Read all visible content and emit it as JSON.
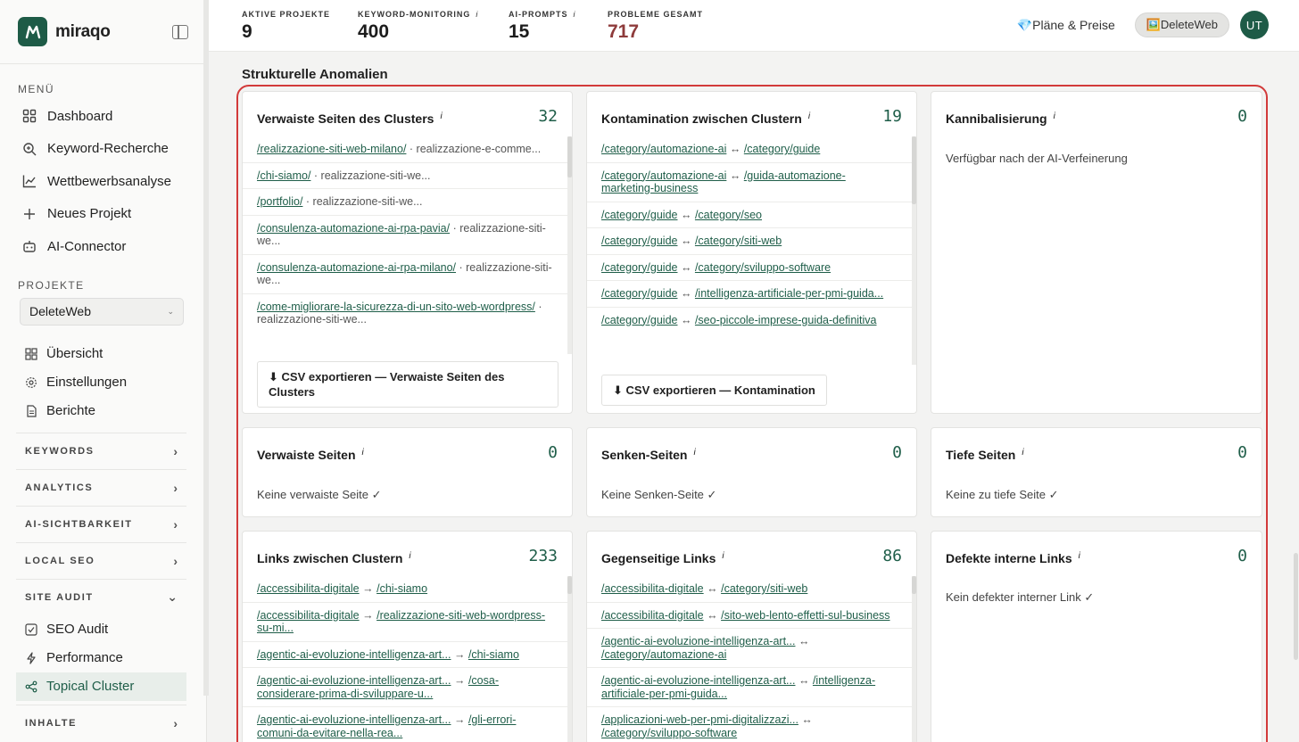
{
  "app": {
    "logo_text": "miraqo"
  },
  "sidebar": {
    "menu_label": "MENÜ",
    "menu_items": [
      {
        "label": "Dashboard",
        "icon": "dashboard-icon"
      },
      {
        "label": "Keyword-Recherche",
        "icon": "search-icon"
      },
      {
        "label": "Wettbewerbsanalyse",
        "icon": "chart-icon"
      },
      {
        "label": "Neues Projekt",
        "icon": "plus-icon"
      },
      {
        "label": "AI-Connector",
        "icon": "robot-icon"
      }
    ],
    "projects_label": "PROJEKTE",
    "project_selected": "DeleteWeb",
    "project_items": [
      {
        "label": "Übersicht",
        "icon": "grid-icon"
      },
      {
        "label": "Einstellungen",
        "icon": "gear-icon"
      },
      {
        "label": "Berichte",
        "icon": "document-icon"
      }
    ],
    "groups": [
      {
        "label": "KEYWORDS"
      },
      {
        "label": "ANALYTICS"
      },
      {
        "label": "AI-SICHTBARKEIT"
      },
      {
        "label": "LOCAL SEO"
      },
      {
        "label": "SITE AUDIT"
      }
    ],
    "site_audit_items": [
      {
        "label": "SEO Audit",
        "icon": "check-square-icon"
      },
      {
        "label": "Performance",
        "icon": "bolt-icon"
      },
      {
        "label": "Topical Cluster",
        "icon": "share-icon"
      }
    ],
    "bottom_group": "INHALTE"
  },
  "header": {
    "stats": [
      {
        "label": "AKTIVE PROJEKTE",
        "value": "9",
        "info": ""
      },
      {
        "label": "KEYWORD-MONITORING",
        "value": "400",
        "info": "i"
      },
      {
        "label": "AI-PROMPTS",
        "value": "15",
        "info": "i"
      },
      {
        "label": "PROBLEME GESAMT",
        "value": "717",
        "info": ""
      }
    ],
    "plans_label": "💎Pläne & Preise",
    "project_pill": "🖼️DeleteWeb",
    "avatar": "UT"
  },
  "main": {
    "section_title": "Strukturelle Anomalien",
    "colors": {
      "accent": "#1f5e49",
      "outline": "#d23a3a",
      "problems": "#8e3b3b"
    },
    "cards": {
      "orphan_cluster": {
        "title": "Verwaiste Seiten des Clusters",
        "info": "i",
        "count": "32",
        "rows": [
          {
            "link": "/realizzazione-siti-web-milano/",
            "sep": " · ",
            "rest": "realizzazione-e-comme..."
          },
          {
            "link": "/chi-siamo/",
            "sep": " · ",
            "rest": "realizzazione-siti-we..."
          },
          {
            "link": "/portfolio/",
            "sep": " · ",
            "rest": "realizzazione-siti-we..."
          },
          {
            "link": "/consulenza-automazione-ai-rpa-pavia/",
            "sep": " · ",
            "rest": "realizzazione-siti-we..."
          },
          {
            "link": "/consulenza-automazione-ai-rpa-milano/",
            "sep": " · ",
            "rest": "realizzazione-siti-we..."
          },
          {
            "link": "/come-migliorare-la-sicurezza-di-un-sito-web-wordpress/",
            "sep": " · ",
            "rest": "realizzazione-siti-we..."
          }
        ],
        "csv": "⬇ CSV exportieren — Verwaiste Seiten des Clusters"
      },
      "contamination": {
        "title": "Kontamination zwischen Clustern",
        "info": "i",
        "count": "19",
        "rows": [
          {
            "link": "/category/automazione-ai",
            "sep": " ↔ ",
            "link2": "/category/guide"
          },
          {
            "link": "/category/automazione-ai",
            "sep": " ↔ ",
            "link2": "/guida-automazione-marketing-business"
          },
          {
            "link": "/category/guide",
            "sep": " ↔ ",
            "link2": "/category/seo"
          },
          {
            "link": "/category/guide",
            "sep": " ↔ ",
            "link2": "/category/siti-web"
          },
          {
            "link": "/category/guide",
            "sep": " ↔ ",
            "link2": "/category/sviluppo-software"
          },
          {
            "link": "/category/guide",
            "sep": " ↔ ",
            "link2": "/intelligenza-artificiale-per-pmi-guida..."
          },
          {
            "link": "/category/guide",
            "sep": " ↔ ",
            "link2": "/seo-piccole-imprese-guida-definitiva"
          }
        ],
        "csv": "⬇ CSV exportieren — Kontamination"
      },
      "cannibal": {
        "title": "Kannibalisierung",
        "info": "i",
        "count": "0",
        "note": "Verfügbar nach der AI-Verfeinerung"
      },
      "orphans": {
        "title": "Verwaiste Seiten",
        "info": "i",
        "count": "0",
        "note": "Keine verwaiste Seite ✓"
      },
      "sinks": {
        "title": "Senken-Seiten",
        "info": "i",
        "count": "0",
        "note": "Keine Senken-Seite ✓"
      },
      "deep": {
        "title": "Tiefe Seiten",
        "info": "i",
        "count": "0",
        "note": "Keine zu tiefe Seite ✓"
      },
      "links_between": {
        "title": "Links zwischen Clustern",
        "info": "i",
        "count": "233",
        "rows": [
          {
            "link": "/accessibilita-digitale",
            "sep": " → ",
            "link2": "/chi-siamo"
          },
          {
            "link": "/accessibilita-digitale",
            "sep": " → ",
            "link2": "/realizzazione-siti-web-wordpress-su-mi..."
          },
          {
            "link": "/agentic-ai-evoluzione-intelligenza-art...",
            "sep": " → ",
            "link2": "/chi-siamo"
          },
          {
            "link": "/agentic-ai-evoluzione-intelligenza-art...",
            "sep": " → ",
            "link2": "/cosa-considerare-prima-di-sviluppare-u..."
          },
          {
            "link": "/agentic-ai-evoluzione-intelligenza-art...",
            "sep": " → ",
            "link2": "/gli-errori-comuni-da-evitare-nella-rea..."
          }
        ]
      },
      "mutual": {
        "title": "Gegenseitige Links",
        "info": "i",
        "count": "86",
        "rows": [
          {
            "link": "/accessibilita-digitale",
            "sep": " ↔ ",
            "link2": "/category/siti-web"
          },
          {
            "link": "/accessibilita-digitale",
            "sep": " ↔ ",
            "link2": "/sito-web-lento-effetti-sul-business"
          },
          {
            "link": "/agentic-ai-evoluzione-intelligenza-art...",
            "sep": " ↔ ",
            "link2": "/category/automazione-ai"
          },
          {
            "link": "/agentic-ai-evoluzione-intelligenza-art...",
            "sep": " ↔ ",
            "link2": "/intelligenza-artificiale-per-pmi-guida..."
          },
          {
            "link": "/applicazioni-web-per-pmi-digitalizzazi...",
            "sep": " ↔ ",
            "link2": "/category/sviluppo-software"
          }
        ]
      },
      "broken": {
        "title": "Defekte interne Links",
        "info": "i",
        "count": "0",
        "note": "Kein defekter interner Link ✓"
      }
    }
  }
}
